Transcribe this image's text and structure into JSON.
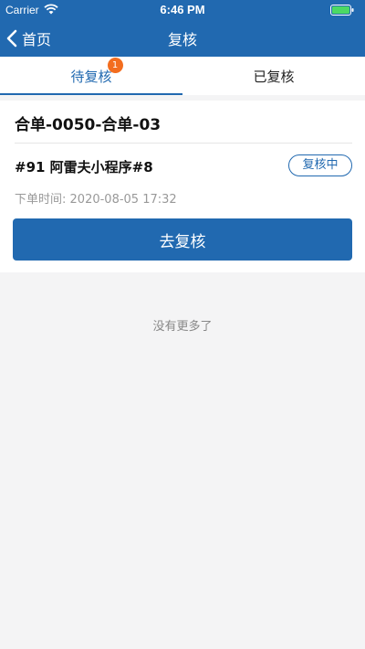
{
  "status_bar": {
    "carrier": "Carrier",
    "time": "6:46 PM",
    "icons": [
      "wifi-icon",
      "battery-icon"
    ]
  },
  "nav": {
    "back_label": "首页",
    "back_icon": "chevron-left-icon",
    "title": "复核"
  },
  "tabs": [
    {
      "label": "待复核",
      "badge": "1",
      "active": true
    },
    {
      "label": "已复核",
      "active": false
    }
  ],
  "order": {
    "title": "合单-0050-合单-03",
    "shop": "#91 阿雷夫小程序#8",
    "status": "复核中",
    "time_label": "下单时间:",
    "time_value": "2020-08-05 17:32",
    "action_label": "去复核"
  },
  "footer": {
    "no_more": "没有更多了"
  },
  "colors": {
    "primary": "#2169b0",
    "badge": "#f36d1f",
    "battery": "#4cd964"
  }
}
